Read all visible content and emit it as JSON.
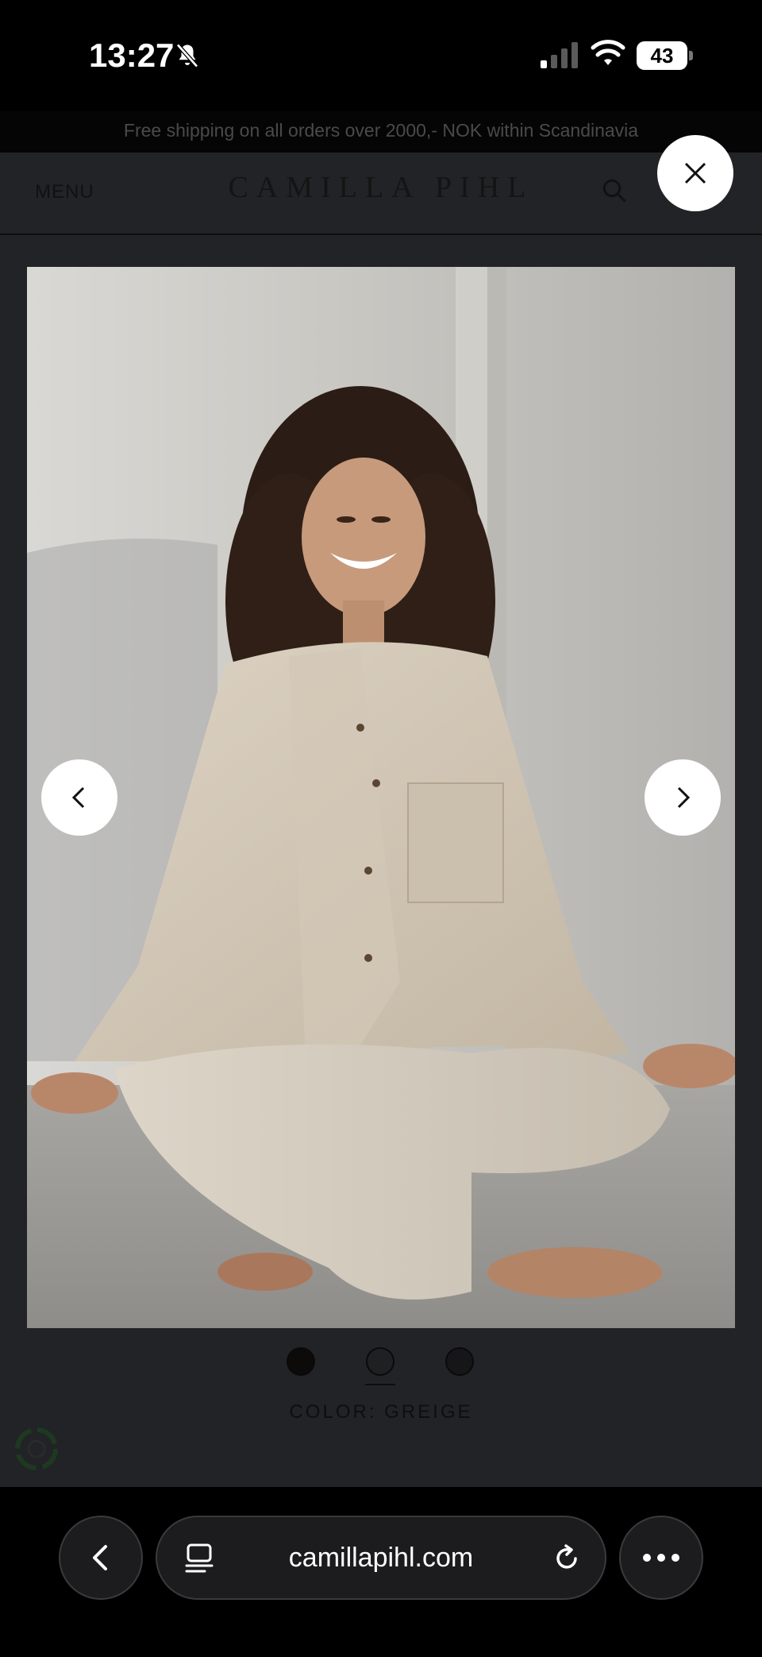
{
  "status_bar": {
    "time": "13:27",
    "battery": "43",
    "icons": [
      "bell-slash-icon",
      "signal-icon",
      "wifi-icon",
      "battery-icon"
    ]
  },
  "site": {
    "promo_text": "Free shipping on all orders over 2000,- NOK within Scandinavia",
    "menu_label": "MENU",
    "logo_text": "CAMILLA PIHL",
    "color_label": "COLOR: GREIGE",
    "swatch_count": 3,
    "selected_swatch": 2
  },
  "lightbox": {
    "icons": {
      "close": "close-icon",
      "prev": "chevron-left-icon",
      "next": "chevron-right-icon"
    }
  },
  "browser": {
    "url": "camillapihl.com",
    "icons": [
      "chevron-left-icon",
      "tabs-icon",
      "reload-icon",
      "more-icon"
    ]
  }
}
